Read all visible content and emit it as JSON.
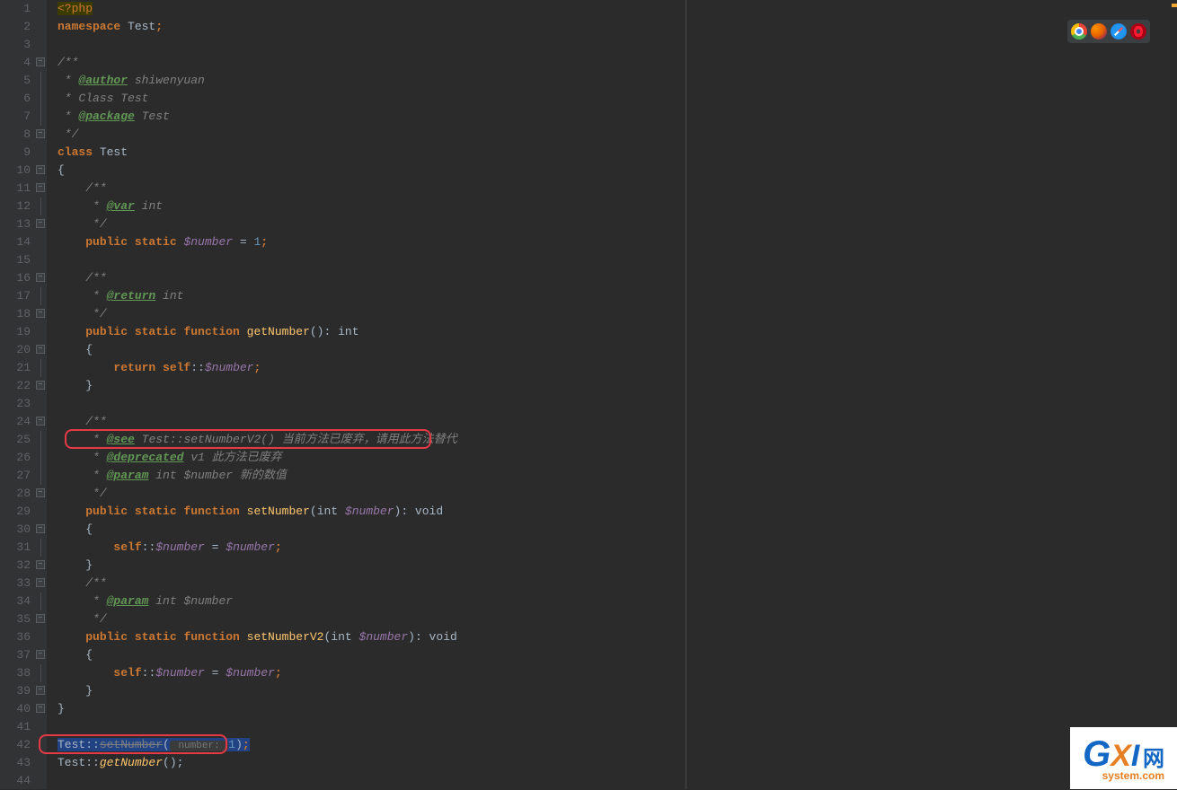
{
  "lines": {
    "l1": {
      "num": "1"
    },
    "l2": {
      "num": "2"
    },
    "l3": {
      "num": "3"
    },
    "l4": {
      "num": "4"
    },
    "l5": {
      "num": "5"
    },
    "l6": {
      "num": "6"
    },
    "l7": {
      "num": "7"
    },
    "l8": {
      "num": "8"
    },
    "l9": {
      "num": "9"
    },
    "l10": {
      "num": "10"
    },
    "l11": {
      "num": "11"
    },
    "l12": {
      "num": "12"
    },
    "l13": {
      "num": "13"
    },
    "l14": {
      "num": "14"
    },
    "l15": {
      "num": "15"
    },
    "l16": {
      "num": "16"
    },
    "l17": {
      "num": "17"
    },
    "l18": {
      "num": "18"
    },
    "l19": {
      "num": "19"
    },
    "l20": {
      "num": "20"
    },
    "l21": {
      "num": "21"
    },
    "l22": {
      "num": "22"
    },
    "l23": {
      "num": "23"
    },
    "l24": {
      "num": "24"
    },
    "l25": {
      "num": "25"
    },
    "l26": {
      "num": "26"
    },
    "l27": {
      "num": "27"
    },
    "l28": {
      "num": "28"
    },
    "l29": {
      "num": "29"
    },
    "l30": {
      "num": "30"
    },
    "l31": {
      "num": "31"
    },
    "l32": {
      "num": "32"
    },
    "l33": {
      "num": "33"
    },
    "l34": {
      "num": "34"
    },
    "l35": {
      "num": "35"
    },
    "l36": {
      "num": "36"
    },
    "l37": {
      "num": "37"
    },
    "l38": {
      "num": "38"
    },
    "l39": {
      "num": "39"
    },
    "l40": {
      "num": "40"
    },
    "l41": {
      "num": "41"
    },
    "l42": {
      "num": "42"
    },
    "l43": {
      "num": "43"
    },
    "l44": {
      "num": "44"
    }
  },
  "code": {
    "phpopen": "<?php",
    "namespace_kw": "namespace ",
    "namespace_name": "Test",
    "semi": ";",
    "doc_open": "/**",
    "doc_star": " * ",
    "doc_close": " */",
    "author_tag": "@author",
    "author_val": " shiwenyuan",
    "class_desc": "Class Test",
    "package_tag": "@package",
    "package_val": " Test",
    "class_kw": "class ",
    "class_name": "Test",
    "brace_open": "{",
    "brace_close": "}",
    "var_tag": "@var",
    "var_type": " int",
    "public_kw": "public ",
    "static_kw": "static ",
    "var_number": "$number",
    "eq": " = ",
    "one": "1",
    "return_tag": "@return",
    "return_type": " int",
    "function_kw": "function ",
    "getnumber": "getNumber",
    "parens": "()",
    "colon_int": ": int",
    "return_kw": "return ",
    "self_kw": "self",
    "dcolon": "::",
    "see_tag": "@see",
    "see_ref": " Test::setNumberV2() ",
    "see_desc": "当前方法已废弃，请用此方法替代",
    "deprecated_tag": "@deprecated",
    "deprecated_ver": " v1 ",
    "deprecated_desc": "此方法已废弃",
    "param_tag": "@param",
    "param_type": " int ",
    "param_var": "$number",
    "param_desc": " 新的数值",
    "setnumber": "setNumber",
    "paren_open": "(",
    "int_kw": "int ",
    "paren_close": ")",
    "colon_void": ": void",
    "setnumberv2": "setNumberV2",
    "test_call": "Test",
    "setnumber_dep": "setNumber",
    "hint_prefix": " number: ",
    "hint_val": "1",
    "getnumber_call": "getNumber",
    "empty_parens_semi": "();"
  },
  "watermark": {
    "g": "G",
    "x": "X",
    "i": "I",
    "wang": "网",
    "sub": "system.com"
  }
}
